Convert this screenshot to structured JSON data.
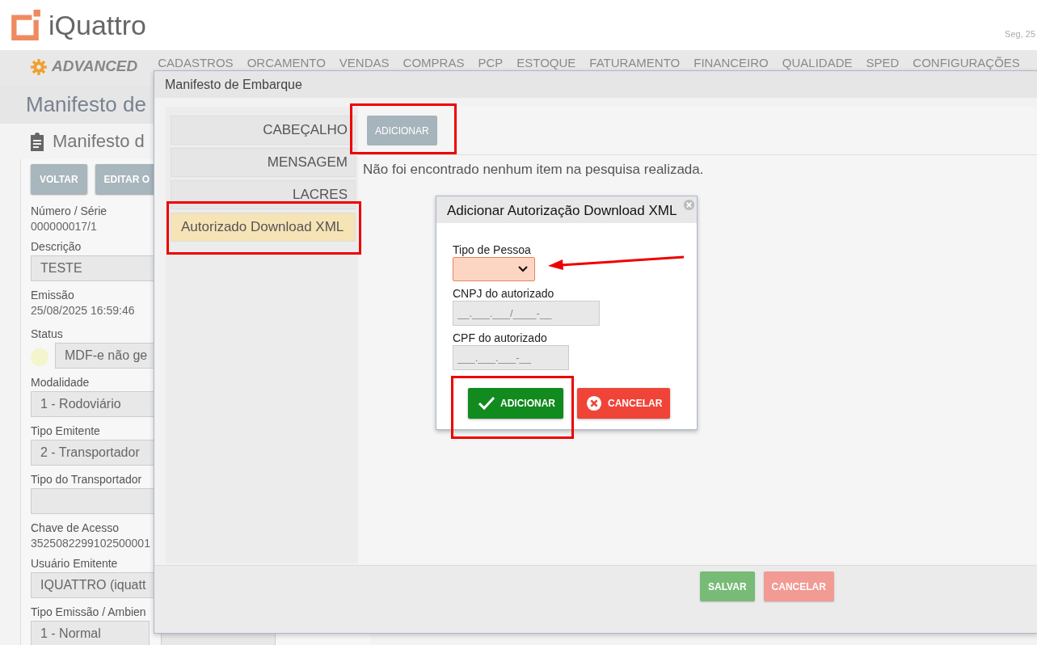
{
  "header": {
    "logo": "iQuattro",
    "date": "Seg, 25"
  },
  "nav": {
    "edition": "ADVANCED",
    "items": [
      "CADASTROS",
      "ORCAMENTO",
      "VENDAS",
      "COMPRAS",
      "PCP",
      "ESTOQUE",
      "FATURAMENTO",
      "FINANCEIRO",
      "QUALIDADE",
      "SPED",
      "CONFIGURAÇÕES"
    ]
  },
  "page": {
    "title": "Manifesto de",
    "subtitle": "Manifesto d",
    "buttons": [
      "VOLTAR",
      "EDITAR O"
    ],
    "fields": [
      {
        "label": "Número / Série",
        "value": "000000017/1",
        "kind": "text"
      },
      {
        "label": "Descrição",
        "value": "TESTE",
        "kind": "input"
      },
      {
        "label": "Emissão",
        "value": "25/08/2025 16:59:46",
        "kind": "text"
      },
      {
        "label": "Status",
        "value": "MDF-e não ge",
        "kind": "status",
        "color": "#f4f5cc"
      },
      {
        "label": "Modalidade",
        "value": "1 - Rodoviário",
        "kind": "input"
      },
      {
        "label": "Tipo Emitente",
        "value": "2 - Transportador",
        "kind": "input"
      },
      {
        "label": "Tipo do Transportador",
        "kind": "input"
      },
      {
        "label": "Chave de Acesso",
        "value": "3525082299102500001",
        "kind": "text"
      },
      {
        "label": "Usuário Emitente",
        "value": "IQUATTRO (iquatt",
        "kind": "input"
      },
      {
        "label": "Tipo Emissão / Ambien",
        "value": "1 - Normal",
        "kind": "pair"
      }
    ]
  },
  "modal": {
    "title": "Manifesto de Embarque",
    "tabs": [
      {
        "label": "CABEÇALHO",
        "selected": false
      },
      {
        "label": "MENSAGEM",
        "selected": false
      },
      {
        "label": "LACRES",
        "selected": false
      },
      {
        "label": "Autorizado Download XML",
        "selected": true
      }
    ],
    "add_button": "ADICIONAR",
    "empty_message": "Não foi encontrado nenhum item na pesquisa realizada.",
    "footer_buttons": [
      {
        "label": "SALVAR",
        "kind": "save"
      },
      {
        "label": "CANCELAR",
        "kind": "cancel"
      }
    ]
  },
  "dialog": {
    "title": "Adicionar Autorização Download XML",
    "fields": [
      {
        "label": "Tipo de Pessoa",
        "kind": "select",
        "invalid": true
      },
      {
        "label": "CNPJ do autorizado",
        "kind": "input",
        "placeholder": "__.___.___/____-__"
      },
      {
        "label": "CPF do autorizado",
        "kind": "input",
        "placeholder": "___.___.___-__"
      }
    ],
    "buttons": [
      {
        "label": "ADICIONAR",
        "kind": "confirm"
      },
      {
        "label": "CANCELAR",
        "kind": "cancel"
      }
    ]
  }
}
